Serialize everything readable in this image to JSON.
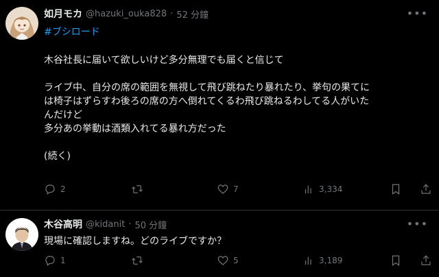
{
  "tweets": [
    {
      "name": "如月モカ",
      "handle": "@hazuki_ouka828",
      "separator": "·",
      "time": "52 分鐘",
      "hashtag": "#ブシロード",
      "lines": [
        "木谷社長に届いて欲しいけど多分無理でも届くと信じて",
        "",
        "ライブ中、自分の席の範囲を無視して飛び跳ねたり暴れたり、挙句の果てに",
        "は椅子はずらすわ後ろの席の方へ倒れてくるわ飛び跳ねるわしてる人がいた",
        "んだけど",
        "多分あの挙動は酒類入れてる暴れ方だった",
        "",
        "(続く)"
      ],
      "replies": "2",
      "retweets": "",
      "likes": "7",
      "views": "3,334"
    },
    {
      "name": "木谷高明",
      "handle": "@kidanit",
      "separator": "·",
      "time": "50 分鐘",
      "text": "現場に確認しますね。どのライブですか？",
      "replies": "1",
      "retweets": "",
      "likes": "5",
      "views": "3,189"
    }
  ],
  "icons": {
    "more": "more-icon",
    "reply": "reply-icon",
    "retweet": "retweet-icon",
    "like": "heart-icon",
    "views": "views-icon",
    "bookmark": "bookmark-icon",
    "share": "share-icon"
  },
  "colors": {
    "background": "#000000",
    "text": "#e7e9ea",
    "secondary": "#71767b",
    "link": "#1d9bf0",
    "divider": "#2f3336"
  }
}
